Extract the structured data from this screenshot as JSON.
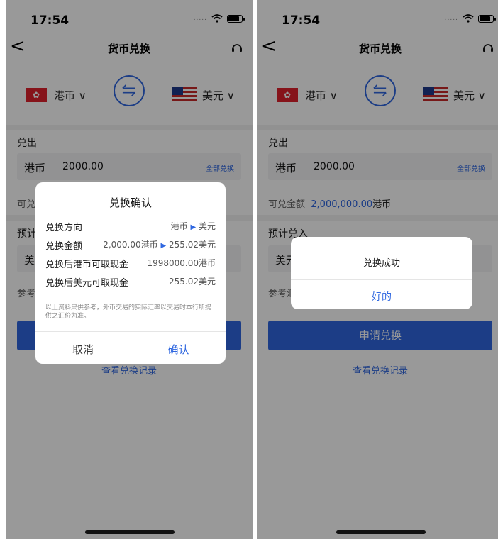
{
  "status": {
    "time": "17:54",
    "signal": "....."
  },
  "nav": {
    "back": "<",
    "title": "货币兑换"
  },
  "currency": {
    "from": "港币 ∨",
    "to": "美元 ∨",
    "hk_flag_glyph": "✿"
  },
  "exchange_out": {
    "label": "兑出",
    "currency": "港币",
    "amount": "2000.00",
    "all_label": "全部兑换"
  },
  "available": {
    "label": "可兑金额",
    "amount": "2,000,000.00",
    "unit": "港币"
  },
  "estimate": {
    "label": "预计兑入",
    "currency": "美元",
    "ref_label": "参考汇率"
  },
  "apply_button": "申请兑换",
  "history_link": "查看兑换记录",
  "confirm_dialog": {
    "title": "兑换确认",
    "rows": [
      {
        "key": "兑换方向",
        "v1": "港币",
        "v2": "美元"
      },
      {
        "key": "兑换金额",
        "v1": "2,000.00港币",
        "v2": "255.02美元"
      },
      {
        "key": "兑换后港币可取现金",
        "value": "1998000.00港币"
      },
      {
        "key": "兑换后美元可取现金",
        "value": "255.02美元"
      }
    ],
    "note": "以上资料只供参考，外币交易的实际汇率以交易时本行所提供之汇价为准。",
    "cancel": "取消",
    "confirm": "确认"
  },
  "success_dialog": {
    "message": "兑换成功",
    "ok": "好的"
  },
  "colors": {
    "accent": "#2f67e0",
    "overlay": "rgba(0,0,0,0.40)"
  }
}
